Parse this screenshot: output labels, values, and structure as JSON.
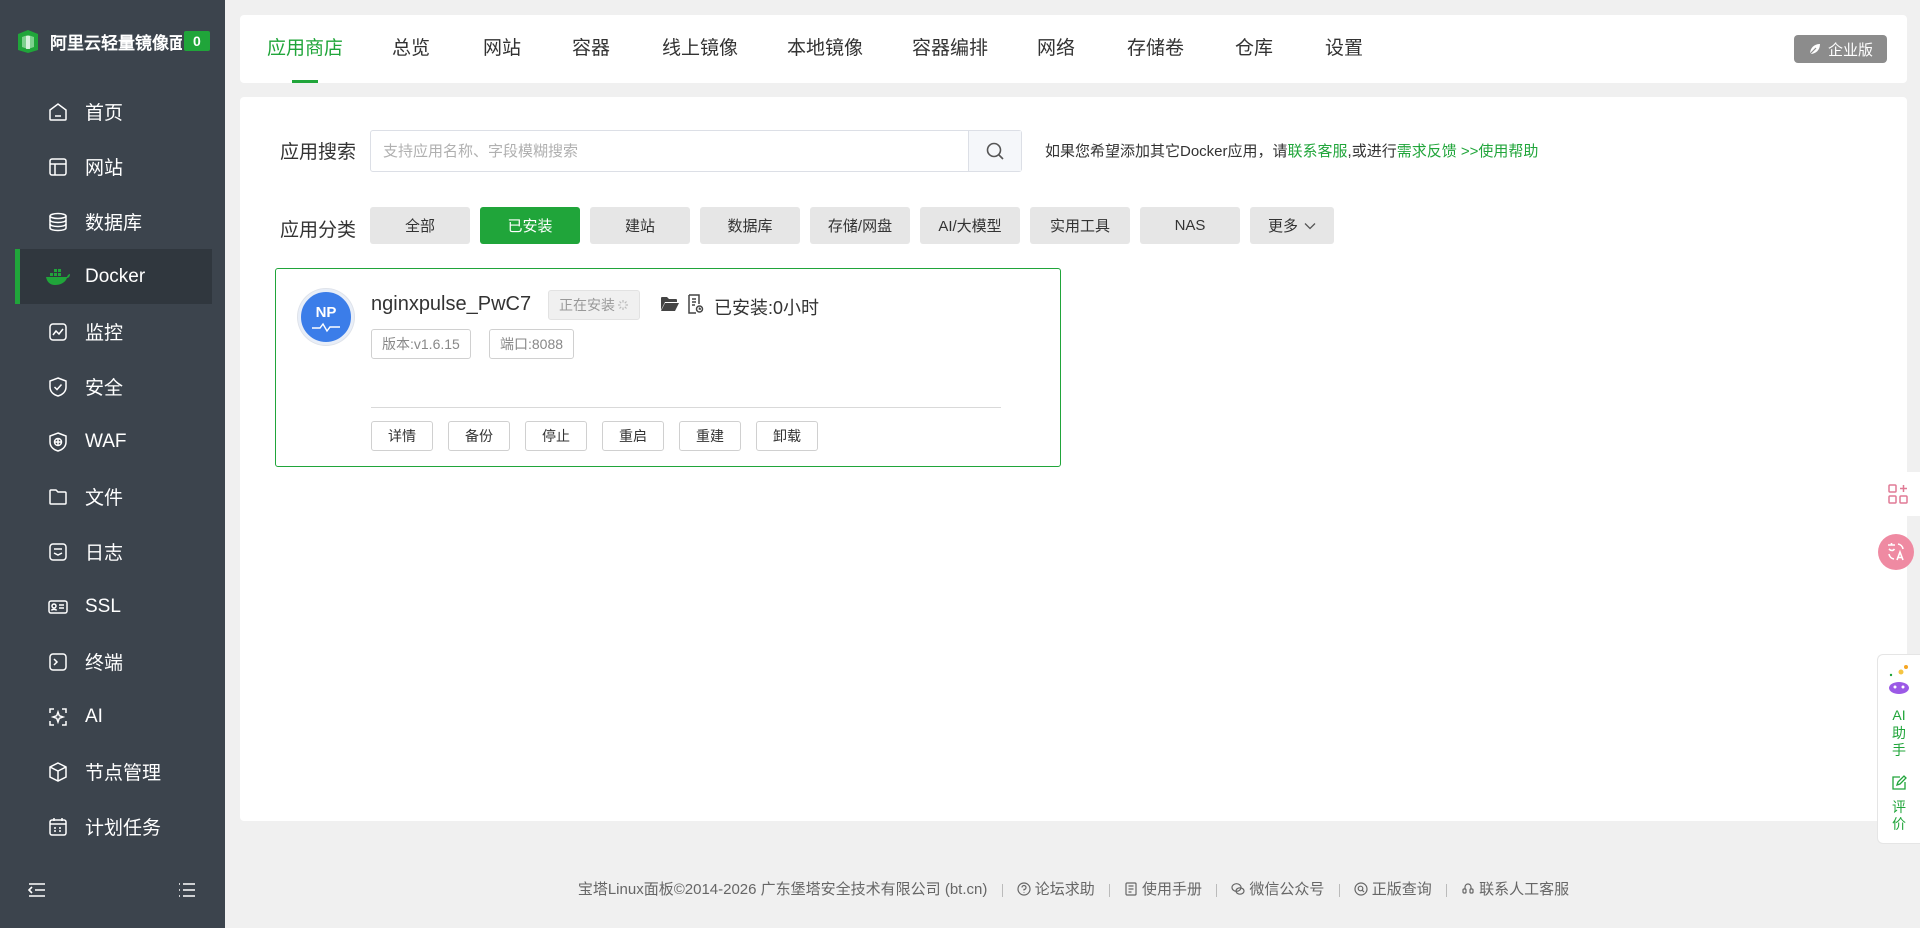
{
  "sidebar": {
    "brand_title": "阿里云轻量镜像面板",
    "brand_badge": "0",
    "items": [
      {
        "label": "首页"
      },
      {
        "label": "网站"
      },
      {
        "label": "数据库"
      },
      {
        "label": "Docker"
      },
      {
        "label": "监控"
      },
      {
        "label": "安全"
      },
      {
        "label": "WAF"
      },
      {
        "label": "文件"
      },
      {
        "label": "日志"
      },
      {
        "label": "SSL"
      },
      {
        "label": "终端"
      },
      {
        "label": "AI"
      },
      {
        "label": "节点管理"
      },
      {
        "label": "计划任务"
      }
    ],
    "active_index": 3
  },
  "tabs": [
    {
      "label": "应用商店"
    },
    {
      "label": "总览"
    },
    {
      "label": "网站"
    },
    {
      "label": "容器"
    },
    {
      "label": "线上镜像"
    },
    {
      "label": "本地镜像"
    },
    {
      "label": "容器编排"
    },
    {
      "label": "网络"
    },
    {
      "label": "存储卷"
    },
    {
      "label": "仓库"
    },
    {
      "label": "设置"
    }
  ],
  "enterprise_label": "企业版",
  "search": {
    "label": "应用搜索",
    "placeholder": "支持应用名称、字段模糊搜索",
    "hint_prefix": "如果您希望添加其它Docker应用，请",
    "hint_link1": "联系客服",
    "hint_mid": ",或进行",
    "hint_link2": "需求反馈",
    "hint_link3": ">>使用帮助"
  },
  "categories": {
    "label": "应用分类",
    "items": [
      "全部",
      "已安装",
      "建站",
      "数据库",
      "存储/网盘",
      "AI/大模型",
      "实用工具",
      "NAS"
    ],
    "active": "已安装",
    "more": "更多"
  },
  "app_card": {
    "avatar_text": "NP",
    "name": "nginxpulse_PwC7",
    "status": "正在安装",
    "installed": "已安装:0小时",
    "version": "版本:v1.6.15",
    "port": "端口:8088",
    "actions": [
      "详情",
      "备份",
      "停止",
      "重启",
      "重建",
      "卸载"
    ]
  },
  "ai_assistant": {
    "label1": "AI",
    "label2": "助",
    "label3": "手",
    "review1": "评",
    "review2": "价"
  },
  "footer": {
    "copyright": "宝塔Linux面板©2014-2026 广东堡塔安全技术有限公司 (bt.cn)",
    "links": [
      "论坛求助",
      "使用手册",
      "微信公众号",
      "正版查询",
      "联系人工客服"
    ]
  },
  "colors": {
    "accent": "#20a53a",
    "sidebar": "#3c444d",
    "avatar": "#3b7de9"
  }
}
